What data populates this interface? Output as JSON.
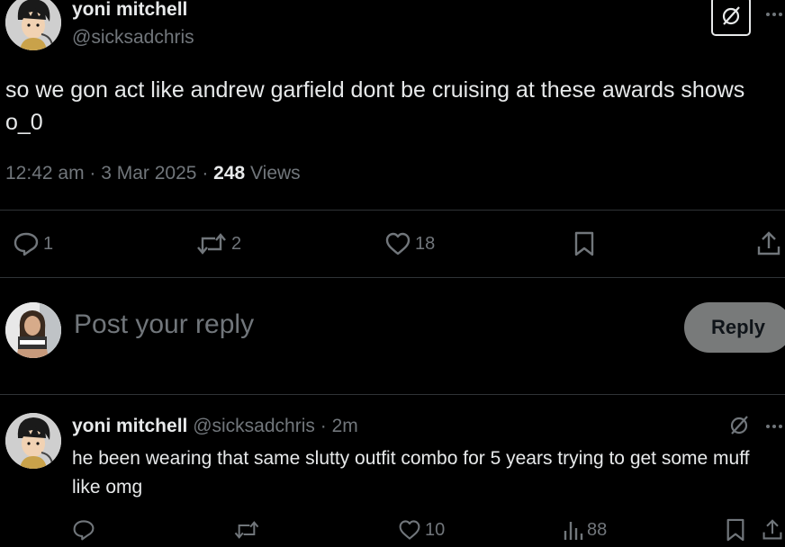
{
  "tweet": {
    "author": {
      "display_name": "yoni mitchell",
      "handle": "@sicksadchris"
    },
    "text": "so we gon act like andrew garfield dont be cruising at these awards shows o_0",
    "time": "12:42 am",
    "date": "3 Mar 2025",
    "views_count": "248",
    "views_label": "Views",
    "stats": {
      "replies": "1",
      "reposts": "2",
      "likes": "18"
    }
  },
  "composer": {
    "placeholder": "Post your reply",
    "reply_button": "Reply"
  },
  "reply": {
    "display_name": "yoni mitchell",
    "handle": "@sicksadchris",
    "time": "2m",
    "text": "he been wearing that same slutty outfit combo for 5 years trying to get some muff like omg",
    "stats": {
      "likes": "10",
      "views": "88"
    }
  },
  "icons": [
    "grok-icon",
    "more-icon",
    "reply-icon",
    "repost-icon",
    "like-icon",
    "bookmark-icon",
    "share-icon",
    "views-icon"
  ],
  "colors": {
    "background": "#000000",
    "text": "#e7e9ea",
    "muted": "#71767b",
    "divider": "#2f3336",
    "reply_button_bg": "#787a7a"
  }
}
